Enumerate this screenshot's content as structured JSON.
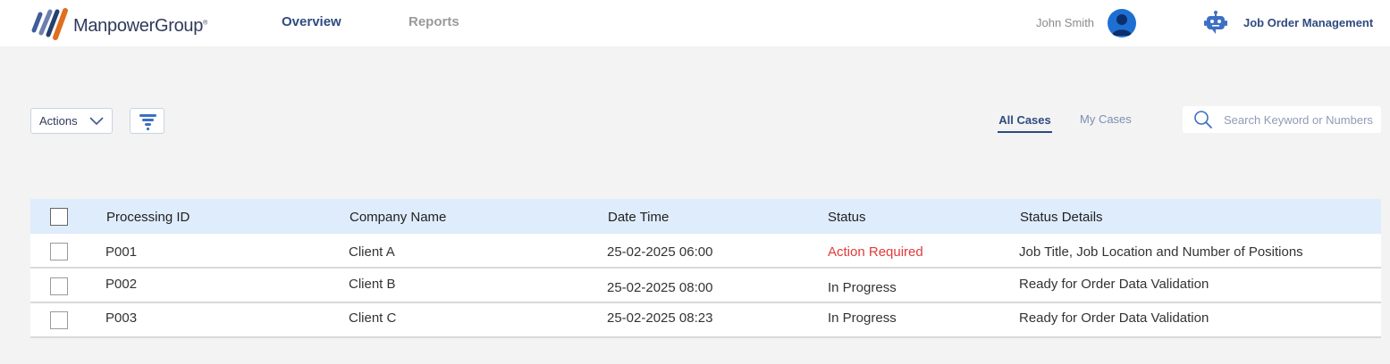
{
  "brand": {
    "name": "ManpowerGroup",
    "trademark": "®"
  },
  "nav": {
    "overview": "Overview",
    "reports": "Reports"
  },
  "user": {
    "name": "John Smith"
  },
  "app": {
    "title": "Job Order Management"
  },
  "toolbar": {
    "actions_label": "Actions"
  },
  "tabs": {
    "all": "All Cases",
    "my": "My Cases"
  },
  "search": {
    "placeholder": "Search Keyword or Numbers",
    "value": ""
  },
  "table": {
    "columns": [
      "Processing ID",
      "Company Name",
      "Date Time",
      "Status",
      "Status Details"
    ],
    "rows": [
      {
        "id": "P001",
        "company": "Client A",
        "datetime": "25-02-2025 06:00",
        "status": "Action Required",
        "details": "Job Title, Job Location and Number of Positions"
      },
      {
        "id": "P002",
        "company": "Client B",
        "datetime": "25-02-2025 08:00",
        "status": "In Progress",
        "details": "Ready for Order Data Validation"
      },
      {
        "id": "P003",
        "company": "Client C",
        "datetime": "25-02-2025 08:23",
        "status": "In Progress",
        "details": "Ready for Order Data Validation"
      }
    ]
  },
  "colors": {
    "brand_navy": "#2e4b80",
    "header_bg": "#dfecfc",
    "alert_red": "#e33a3a",
    "avatar_blue": "#1e6fd2"
  }
}
